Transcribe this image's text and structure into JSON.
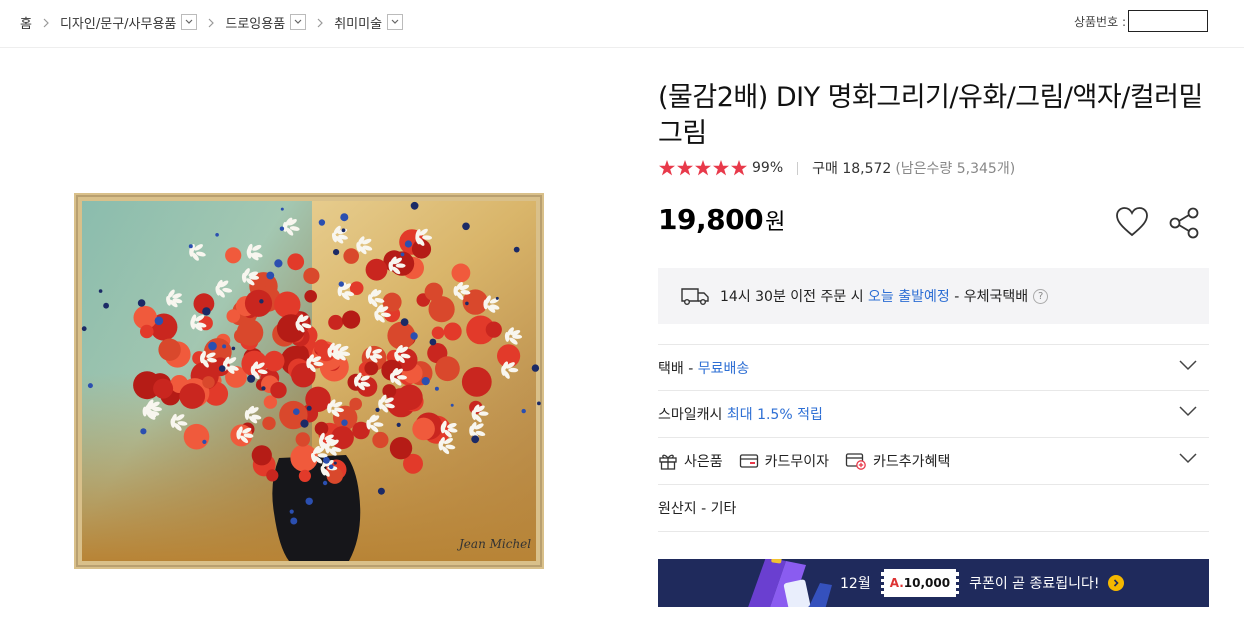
{
  "breadcrumb": {
    "home": "홈",
    "items": [
      {
        "label": "디자인/문구/사무용품"
      },
      {
        "label": "드로잉용품"
      },
      {
        "label": "취미미술"
      }
    ]
  },
  "product_no": {
    "label": "상품번호 :",
    "value": ""
  },
  "product": {
    "title": "(물감2배) DIY 명화그리기/유화/그림/액자/컬러밑그림",
    "rating_percent": "99%",
    "purchase_label": "구매 18,572",
    "stock_text": "(남은수량 5,345개)",
    "stars": 5,
    "price": "19,800",
    "price_unit": "원"
  },
  "shipping": {
    "prefix": "14시 30분 이전 주문 시",
    "highlight": "오늘 출발예정",
    "suffix": "- 우체국택배",
    "help": "?"
  },
  "rows": {
    "delivery_label": "택배 -",
    "delivery_value": "무료배송",
    "smile_label": "스마일캐시",
    "smile_value": "최대 1.5% 적립",
    "gift": "사은품",
    "card_interest": "카드무이자",
    "card_benefit": "카드추가혜택",
    "origin": "원산지 - 기타"
  },
  "banner": {
    "month": "12월",
    "coupon_prefix": "A.",
    "coupon_value": "10,000",
    "message": "쿠폰이 곧 종료됩니다!"
  },
  "colors": {
    "star": "#e8394a",
    "link_blue": "#2e6fd4",
    "banner_bg": "#1f2a5c",
    "banner_arrow": "#f5b800"
  },
  "icons": [
    "chevron-right-icon",
    "dropdown-icon",
    "heart-icon",
    "share-icon",
    "truck-icon",
    "gift-icon",
    "card-icon",
    "card-plus-icon",
    "chevron-down-icon"
  ]
}
